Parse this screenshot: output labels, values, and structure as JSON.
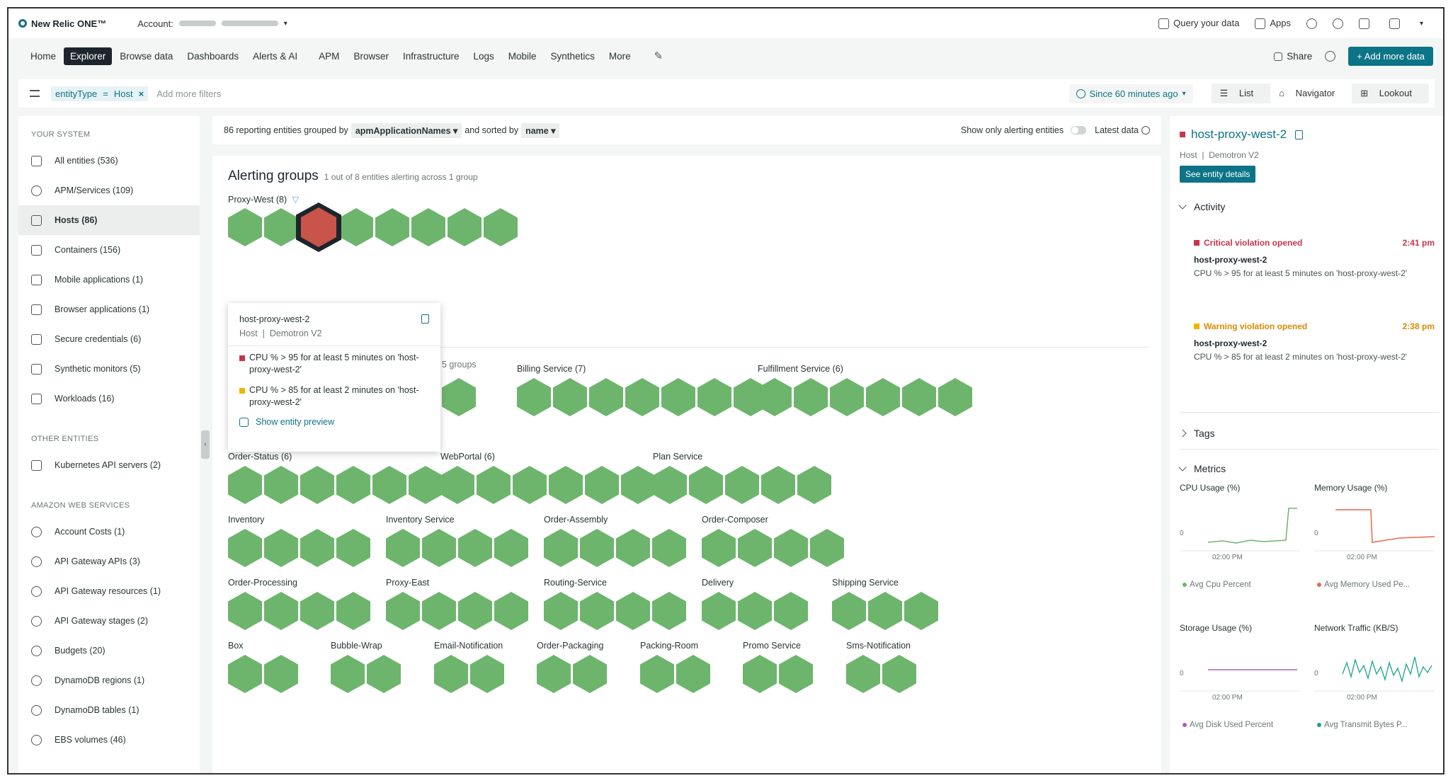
{
  "app": {
    "logo": "New Relic ONE™",
    "account_label": "Account:"
  },
  "topbar": {
    "query": "Query your data",
    "apps": "Apps"
  },
  "nav": {
    "items": [
      "Home",
      "Explorer",
      "Browse data",
      "Dashboards",
      "Alerts & AI",
      "APM",
      "Browser",
      "Infrastructure",
      "Logs",
      "Mobile",
      "Synthetics",
      "More"
    ],
    "active": "Explorer",
    "share": "Share",
    "add_data": "Add more data"
  },
  "filter": {
    "key": "entityType",
    "op": "=",
    "value": "Host",
    "placeholder": "Add more filters",
    "time": "Since 60 minutes ago",
    "views": [
      "List",
      "Navigator",
      "Lookout"
    ],
    "active_view": "Navigator"
  },
  "sidebar": {
    "your_system_title": "YOUR SYSTEM",
    "your_system": [
      {
        "label": "All entities (536)",
        "icon": "grid-icon"
      },
      {
        "label": "APM/Services (109)",
        "icon": "globe-icon"
      },
      {
        "label": "Hosts (86)",
        "icon": "host-icon",
        "active": true
      },
      {
        "label": "Containers (156)",
        "icon": "container-icon"
      },
      {
        "label": "Mobile applications (1)",
        "icon": "mobile-icon"
      },
      {
        "label": "Browser applications (1)",
        "icon": "browser-icon"
      },
      {
        "label": "Secure credentials (6)",
        "icon": "lock-icon"
      },
      {
        "label": "Synthetic monitors (5)",
        "icon": "runner-icon"
      },
      {
        "label": "Workloads (16)",
        "icon": "workload-icon"
      }
    ],
    "other_title": "OTHER ENTITIES",
    "other": [
      {
        "label": "Kubernetes API servers (2)",
        "icon": "box-icon"
      }
    ],
    "aws_title": "AMAZON WEB SERVICES",
    "aws": [
      {
        "label": "Account Costs (1)",
        "icon": "cloud-icon"
      },
      {
        "label": "API Gateway APIs (3)",
        "icon": "cloud-icon"
      },
      {
        "label": "API Gateway resources (1)",
        "icon": "cloud-icon"
      },
      {
        "label": "API Gateway stages (2)",
        "icon": "cloud-icon"
      },
      {
        "label": "Budgets (20)",
        "icon": "cloud-icon"
      },
      {
        "label": "DynamoDB regions (1)",
        "icon": "cloud-icon"
      },
      {
        "label": "DynamoDB tables (1)",
        "icon": "cloud-icon"
      },
      {
        "label": "EBS volumes (46)",
        "icon": "cloud-icon"
      }
    ]
  },
  "groupbar": {
    "count_text": "86 reporting entities grouped by",
    "group_by": "apmApplicationNames",
    "sorted_text": "and sorted by",
    "sort_by": "name",
    "alert_toggle": "Show only alerting entities",
    "latest": "Latest data"
  },
  "alerting": {
    "title": "Alerting groups",
    "subtitle": "1 out of 8 entities alerting across 1 group",
    "group": "Proxy-West (8)"
  },
  "popup": {
    "name": "host-proxy-west-2",
    "type": "Host",
    "account": "Demotron V2",
    "conditions": [
      {
        "text": "CPU % > 95 for at least 5 minutes on 'host-proxy-west-2'",
        "color": "#c9344a"
      },
      {
        "text": "CPU % > 85 for at least 2 minutes on 'host-proxy-west-2'",
        "color": "#f0b400"
      }
    ],
    "link": "Show entity preview",
    "hidden_suffix": "5 groups"
  },
  "groups": [
    {
      "label": "Billing Service (7)",
      "count": 7
    },
    {
      "label": "Fulfillment Service (6)",
      "count": 6
    },
    {
      "label": "Order-Status (6)",
      "count": 6
    },
    {
      "label": "WebPortal (6)",
      "count": 6
    },
    {
      "label": "Plan Service",
      "count": 5
    },
    {
      "label": "Inventory",
      "count": 4
    },
    {
      "label": "Inventory Service",
      "count": 4
    },
    {
      "label": "Order-Assembly",
      "count": 4
    },
    {
      "label": "Order-Composer",
      "count": 4
    },
    {
      "label": "Order-Processing",
      "count": 4
    },
    {
      "label": "Proxy-East",
      "count": 4
    },
    {
      "label": "Routing-Service",
      "count": 4
    },
    {
      "label": "Delivery",
      "count": 3
    },
    {
      "label": "Shipping Service",
      "count": 3
    },
    {
      "label": "Box",
      "count": 2
    },
    {
      "label": "Bubble-Wrap",
      "count": 2
    },
    {
      "label": "Email-Notification",
      "count": 2
    },
    {
      "label": "Order-Packaging",
      "count": 2
    },
    {
      "label": "Packing-Room",
      "count": 2
    },
    {
      "label": "Promo Service",
      "count": 2
    },
    {
      "label": "Sms-Notification",
      "count": 2
    }
  ],
  "panel": {
    "name": "host-proxy-west-2",
    "type": "Host",
    "account": "Demotron V2",
    "details_btn": "See entity details",
    "activity_title": "Activity",
    "activity": [
      {
        "title": "Critical violation opened",
        "time": "2:41 pm",
        "color": "#c9344a",
        "entity": "host-proxy-west-2",
        "desc": "CPU % > 95 for at least 5 minutes on 'host-proxy-west-2'"
      },
      {
        "title": "Warning violation opened",
        "time": "2:38 pm",
        "color": "#d98a00",
        "entity": "host-proxy-west-2",
        "desc": "CPU % > 85 for at least 2 minutes on 'host-proxy-west-2'"
      }
    ],
    "tags_title": "Tags",
    "metrics_title": "Metrics",
    "metrics": [
      {
        "title": "CPU Usage (%)",
        "legend": "Avg Cpu Percent",
        "color": "#6db56d",
        "tick": "02:00 PM",
        "zero": "0"
      },
      {
        "title": "Memory Usage (%)",
        "legend": "Avg Memory Used Pe...",
        "color": "#e8694a",
        "tick": "02:00 PM",
        "zero": "0"
      },
      {
        "title": "Storage Usage (%)",
        "legend": "Avg Disk Used Percent",
        "color": "#b05cc0",
        "tick": "02:00 PM",
        "zero": "0"
      },
      {
        "title": "Network Traffic (KB/S)",
        "legend": "Avg Transmit Bytes P...",
        "color": "#1aa38c",
        "tick": "02:00 PM",
        "zero": "0"
      }
    ]
  }
}
